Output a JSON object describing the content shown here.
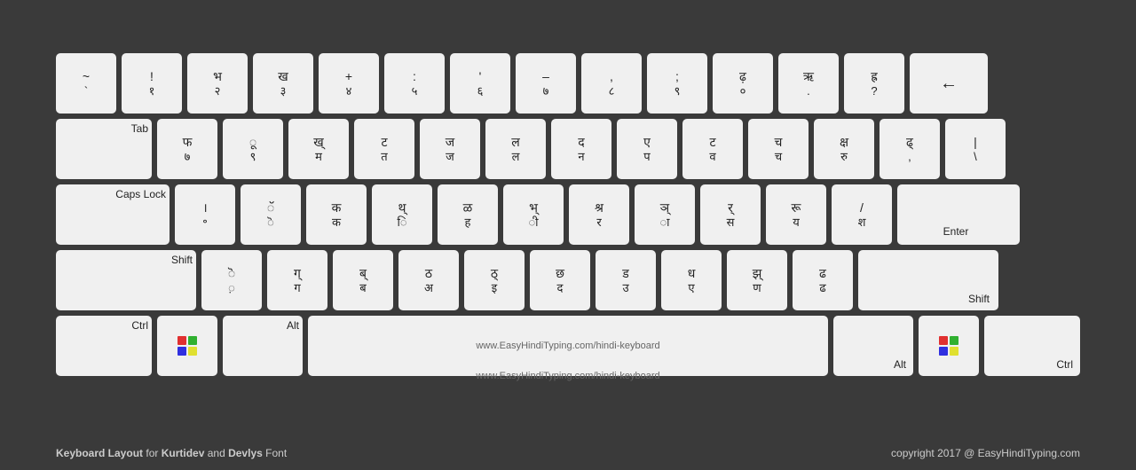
{
  "keyboard": {
    "rows": [
      {
        "keys": [
          {
            "label": "",
            "top": "~",
            "bot": "`",
            "width": "normal"
          },
          {
            "label": "",
            "top": "!",
            "bot": "१",
            "width": "normal"
          },
          {
            "label": "",
            "top": "भ",
            "bot": "२",
            "width": "normal"
          },
          {
            "label": "",
            "top": "ख",
            "bot": "३",
            "width": "normal"
          },
          {
            "label": "",
            "top": "+",
            "bot": "४",
            "width": "normal"
          },
          {
            "label": "",
            "top": ":",
            "bot": "५",
            "width": "normal"
          },
          {
            "label": "",
            "top": "'",
            "bot": "६",
            "width": "normal"
          },
          {
            "label": "",
            "top": "–",
            "bot": "७",
            "width": "normal"
          },
          {
            "label": "",
            "top": ",",
            "bot": "८",
            "width": "normal"
          },
          {
            "label": "",
            "top": ";",
            "bot": "९",
            "width": "normal"
          },
          {
            "label": "",
            "top": "ढ़",
            "bot": "०",
            "width": "normal"
          },
          {
            "label": "",
            "top": "ऋ",
            "bot": ".",
            "width": "normal"
          },
          {
            "label": "",
            "top": "ह्र",
            "bot": "?",
            "width": "normal"
          },
          {
            "label": "←",
            "top": "",
            "bot": "",
            "width": "backspace"
          }
        ]
      },
      {
        "keys": [
          {
            "label": "Tab",
            "top": "",
            "bot": "",
            "width": "tab"
          },
          {
            "label": "",
            "top": "फ",
            "bot": "७",
            "width": "normal"
          },
          {
            "label": "",
            "top": "ू",
            "bot": "९",
            "width": "normal"
          },
          {
            "label": "",
            "top": "ख",
            "bot": "म",
            "width": "normal"
          },
          {
            "label": "",
            "top": "ट",
            "bot": "त",
            "width": "normal"
          },
          {
            "label": "",
            "top": "ज",
            "bot": "ज",
            "width": "normal"
          },
          {
            "label": "",
            "top": "ल",
            "bot": "ल",
            "width": "normal"
          },
          {
            "label": "",
            "top": "द",
            "bot": "न",
            "width": "normal"
          },
          {
            "label": "",
            "top": "ए",
            "bot": "प",
            "width": "normal"
          },
          {
            "label": "",
            "top": "ट",
            "bot": "व",
            "width": "normal"
          },
          {
            "label": "",
            "top": "च",
            "bot": "च",
            "width": "normal"
          },
          {
            "label": "",
            "top": "क्ष",
            "bot": "रु",
            "width": "normal"
          },
          {
            "label": "",
            "top": "ढ्",
            "bot": ",",
            "width": "normal"
          },
          {
            "label": "",
            "top": "",
            "bot": "",
            "width": "enter-top"
          }
        ]
      },
      {
        "keys": [
          {
            "label": "Caps Lock",
            "top": "",
            "bot": "",
            "width": "caps"
          },
          {
            "label": "",
            "top": "।",
            "bot": "॰",
            "width": "normal"
          },
          {
            "label": "",
            "top": "ॅ",
            "bot": "ॆ",
            "width": "normal"
          },
          {
            "label": "",
            "top": "क",
            "bot": "क",
            "width": "normal"
          },
          {
            "label": "",
            "top": "थ्",
            "bot": "ि",
            "width": "normal"
          },
          {
            "label": "",
            "top": "ळ",
            "bot": "ह",
            "width": "normal"
          },
          {
            "label": "",
            "top": "भ्",
            "bot": "ी",
            "width": "normal"
          },
          {
            "label": "",
            "top": "श्र",
            "bot": "र",
            "width": "normal"
          },
          {
            "label": "",
            "top": "ञ्",
            "bot": "ा",
            "width": "normal"
          },
          {
            "label": "",
            "top": "र्",
            "bot": "स",
            "width": "normal"
          },
          {
            "label": "",
            "top": "रू",
            "bot": "य",
            "width": "normal"
          },
          {
            "label": "",
            "top": "/",
            "bot": "श",
            "width": "normal"
          },
          {
            "label": "Enter",
            "top": "",
            "bot": "",
            "width": "enter"
          }
        ]
      },
      {
        "keys": [
          {
            "label": "Shift",
            "top": "",
            "bot": "",
            "width": "shift-l"
          },
          {
            "label": "",
            "top": "ॆ",
            "bot": "़",
            "width": "normal"
          },
          {
            "label": "",
            "top": "ग्",
            "bot": "ग",
            "width": "normal"
          },
          {
            "label": "",
            "top": "ब्",
            "bot": "ब",
            "width": "normal"
          },
          {
            "label": "",
            "top": "ठ",
            "bot": "अ",
            "width": "normal"
          },
          {
            "label": "",
            "top": "ठ्",
            "bot": "इ",
            "width": "normal"
          },
          {
            "label": "",
            "top": "छ",
            "bot": "द",
            "width": "normal"
          },
          {
            "label": "",
            "top": "ड",
            "bot": "उ",
            "width": "normal"
          },
          {
            "label": "",
            "top": "ध",
            "bot": "ए",
            "width": "normal"
          },
          {
            "label": "",
            "top": "झ्",
            "bot": "ण",
            "width": "normal"
          },
          {
            "label": "",
            "top": "ढ",
            "bot": "ढ",
            "width": "normal"
          },
          {
            "label": "Shift",
            "top": "",
            "bot": "",
            "width": "shift-r"
          }
        ]
      },
      {
        "keys": [
          {
            "label": "Ctrl",
            "top": "",
            "bot": "",
            "width": "ctrl"
          },
          {
            "label": "win",
            "top": "",
            "bot": "",
            "width": "win"
          },
          {
            "label": "Alt",
            "top": "",
            "bot": "",
            "width": "alt"
          },
          {
            "label": "www.EasyHindiTyping.com/hindi-keyboard",
            "top": "",
            "bot": "",
            "width": "space"
          },
          {
            "label": "Alt",
            "top": "",
            "bot": "",
            "width": "alt"
          },
          {
            "label": "win",
            "top": "",
            "bot": "",
            "width": "win"
          },
          {
            "label": "Ctrl",
            "top": "",
            "bot": "",
            "width": "ctrl"
          }
        ]
      }
    ],
    "footer": {
      "left": "Keyboard Layout for Kurtidev and Devlys Font",
      "right": "copyright 2017 @ EasyHindiTyping.com"
    }
  }
}
